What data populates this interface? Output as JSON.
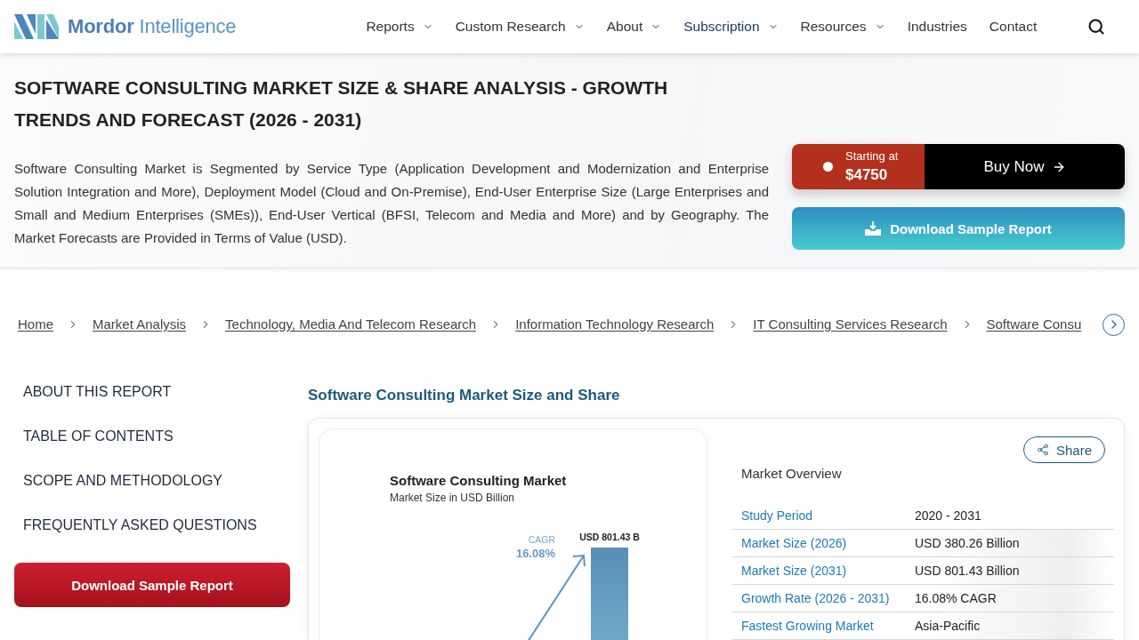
{
  "header": {
    "logo": {
      "text": "**Mordor** Intelligence"
    },
    "nav": [
      {
        "label": "Reports",
        "kind": "dropdown",
        "selected": false
      },
      {
        "label": "Custom Research",
        "kind": "dropdown",
        "selected": false
      },
      {
        "label": "About",
        "kind": "dropdown",
        "selected": false
      },
      {
        "label": "Subscription",
        "kind": "dropdown",
        "selected": true
      },
      {
        "label": "Resources",
        "kind": "dropdown",
        "selected": false
      },
      {
        "label": "Industries",
        "kind": "link",
        "selected": false
      },
      {
        "label": "Contact",
        "kind": "link",
        "selected": false
      }
    ]
  },
  "hero": {
    "title": "SOFTWARE CONSULTING MARKET SIZE & SHARE ANALYSIS - GROWTH TRENDS AND FORECAST (2026 - 2031)",
    "description": "Software Consulting Market is Segmented by Service Type (Application Development and Modernization and Enterprise Solution Integration and More), Deployment Model (Cloud and On-Premise), End-User Enterprise Size (Large Enterprises and Small and Medium Enterprises (SMEs)), End-User Vertical (BFSI, Telecom and Media and More) and by Geography. The Market Forecasts are Provided in Terms of Value (USD).",
    "price": {
      "caption": "Starting at",
      "amount": "$4750"
    },
    "buy_button": "Buy Now",
    "download_button": "Download Sample Report"
  },
  "breadcrumb": [
    "Home",
    "Market Analysis",
    "Technology, Media And Telecom Research",
    "Information Technology Research",
    "IT Consulting Services Research",
    "Software Consu"
  ],
  "sidebar": {
    "items": [
      "ABOUT THIS REPORT",
      "TABLE OF CONTENTS",
      "SCOPE AND METHODOLOGY",
      "FREQUENTLY ASKED QUESTIONS"
    ],
    "download_button": "Download Sample Report"
  },
  "main": {
    "heading": "Software Consulting Market Size and Share",
    "infographic": {
      "title": "Software Consulting Market",
      "subtitle": "Market Size in USD Billion",
      "cagr_label": "CAGR",
      "cagr_value": "16.08%",
      "bar_label": "USD 801.43 B"
    },
    "share_button": "Share",
    "overview_title": "Market Overview",
    "overview": [
      {
        "label": "Study Period",
        "value": "2020 - 2031"
      },
      {
        "label": "Market Size (2026)",
        "value": "USD 380.26 Billion"
      },
      {
        "label": "Market Size (2031)",
        "value": "USD 801.43 Billion"
      },
      {
        "label": "Growth Rate (2026 - 2031)",
        "value": "16.08% CAGR"
      },
      {
        "label": "Fastest Growing Market",
        "value": "Asia-Pacific"
      }
    ]
  }
}
